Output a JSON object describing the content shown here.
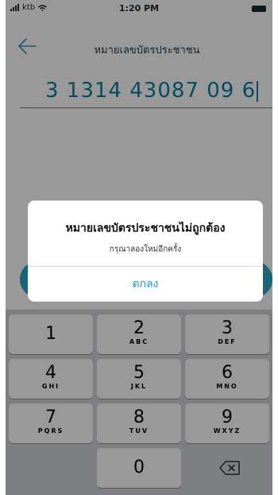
{
  "status_bar": {
    "carrier": "ktb",
    "wifi_icon": "wifi-icon",
    "time": "1:20 PM"
  },
  "header": {
    "title": "หมายเลขบัตรประชาชน"
  },
  "id_input": {
    "value": "3 1314 43087 09 6"
  },
  "keypad": {
    "rows": [
      [
        {
          "digit": "1",
          "letters": ""
        },
        {
          "digit": "2",
          "letters": "ABC"
        },
        {
          "digit": "3",
          "letters": "DEF"
        }
      ],
      [
        {
          "digit": "4",
          "letters": "GHI"
        },
        {
          "digit": "5",
          "letters": "JKL"
        },
        {
          "digit": "6",
          "letters": "MNO"
        }
      ],
      [
        {
          "digit": "7",
          "letters": "PQRS"
        },
        {
          "digit": "8",
          "letters": "TUV"
        },
        {
          "digit": "9",
          "letters": "WXYZ"
        }
      ],
      [
        {
          "digit": "0",
          "letters": ""
        }
      ]
    ],
    "backspace_icon": "backspace-icon"
  },
  "alert": {
    "title": "หมายเลขบัตรประชาชนไม่ถูกต้อง",
    "message": "กรุณาลองใหม่อีกครั้ง",
    "button_label": "ตกลง"
  },
  "colors": {
    "accent": "#1f9cbf",
    "button": "#2aa7c6",
    "keypad_bg": "#d1d4da"
  }
}
